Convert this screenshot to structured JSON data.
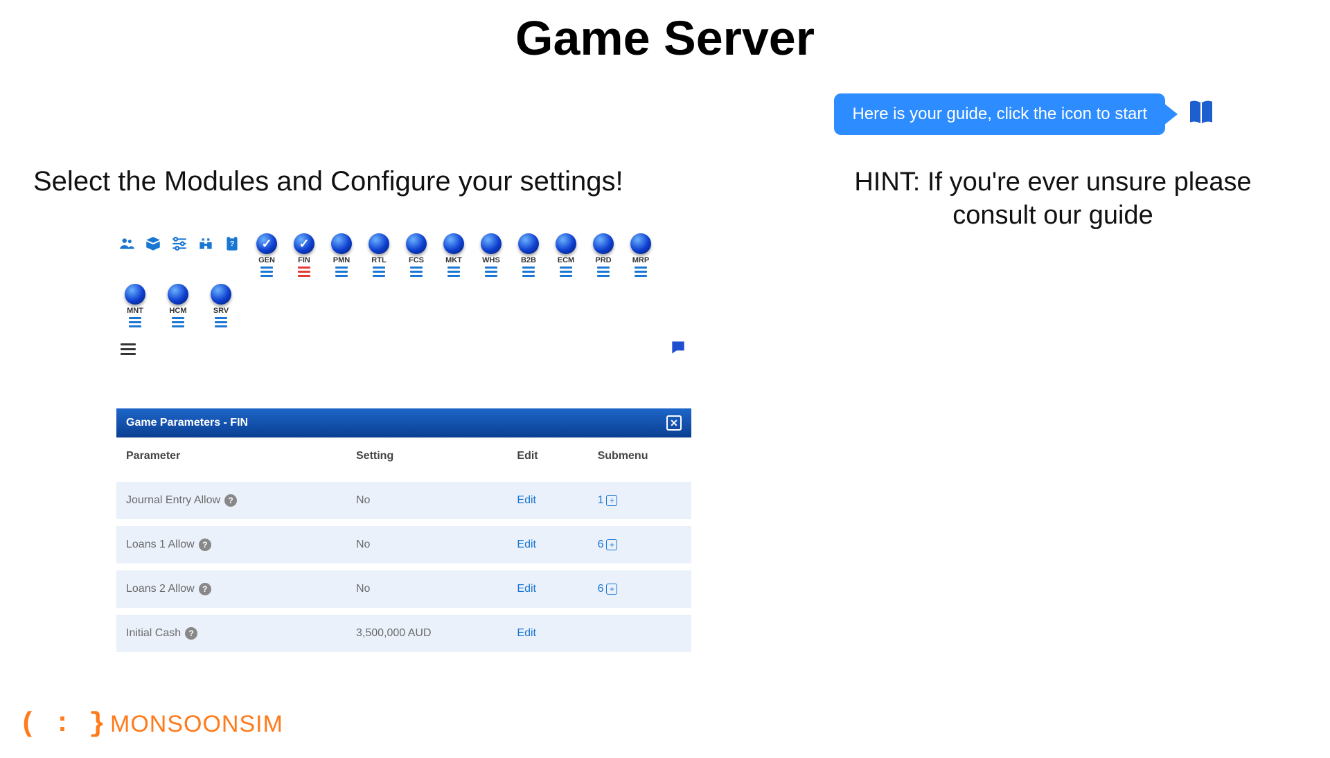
{
  "page_title": "Game Server",
  "guide": {
    "bubble_text": "Here is your guide, click the icon to start"
  },
  "left_heading": "Select the Modules and Configure your settings!",
  "right_hint": "HINT: If you're ever unsure please consult our guide",
  "toolbar": {
    "icons": [
      "group-icon",
      "box-icon",
      "sliders-icon",
      "binoculars-icon",
      "clipboard-help-icon"
    ]
  },
  "modules_row1": [
    {
      "code": "GEN",
      "checked": true,
      "bars": "blue"
    },
    {
      "code": "FIN",
      "checked": true,
      "bars": "red"
    },
    {
      "code": "PMN",
      "checked": false,
      "bars": "blue"
    },
    {
      "code": "RTL",
      "checked": false,
      "bars": "blue"
    },
    {
      "code": "FCS",
      "checked": false,
      "bars": "blue"
    },
    {
      "code": "MKT",
      "checked": false,
      "bars": "blue"
    },
    {
      "code": "WHS",
      "checked": false,
      "bars": "blue"
    },
    {
      "code": "B2B",
      "checked": false,
      "bars": "blue"
    },
    {
      "code": "ECM",
      "checked": false,
      "bars": "blue"
    },
    {
      "code": "PRD",
      "checked": false,
      "bars": "blue"
    },
    {
      "code": "MRP",
      "checked": false,
      "bars": "blue"
    }
  ],
  "modules_row2": [
    {
      "code": "MNT",
      "checked": false,
      "bars": "blue"
    },
    {
      "code": "HCM",
      "checked": false,
      "bars": "blue"
    },
    {
      "code": "SRV",
      "checked": false,
      "bars": "blue"
    }
  ],
  "param_panel": {
    "title": "Game Parameters - FIN",
    "columns": [
      "Parameter",
      "Setting",
      "Edit",
      "Submenu"
    ],
    "edit_label": "Edit",
    "rows": [
      {
        "param": "Journal Entry Allow",
        "setting": "No",
        "edit": true,
        "submenu": "1"
      },
      {
        "param": "Loans 1 Allow",
        "setting": "No",
        "edit": true,
        "submenu": "6"
      },
      {
        "param": "Loans 2 Allow",
        "setting": "No",
        "edit": true,
        "submenu": "6"
      },
      {
        "param": "Initial Cash",
        "setting": "3,500,000 AUD",
        "edit": true,
        "submenu": ""
      }
    ]
  },
  "footer": {
    "brand_brace": "( : }",
    "brand_text": "MONSOONSIM"
  }
}
